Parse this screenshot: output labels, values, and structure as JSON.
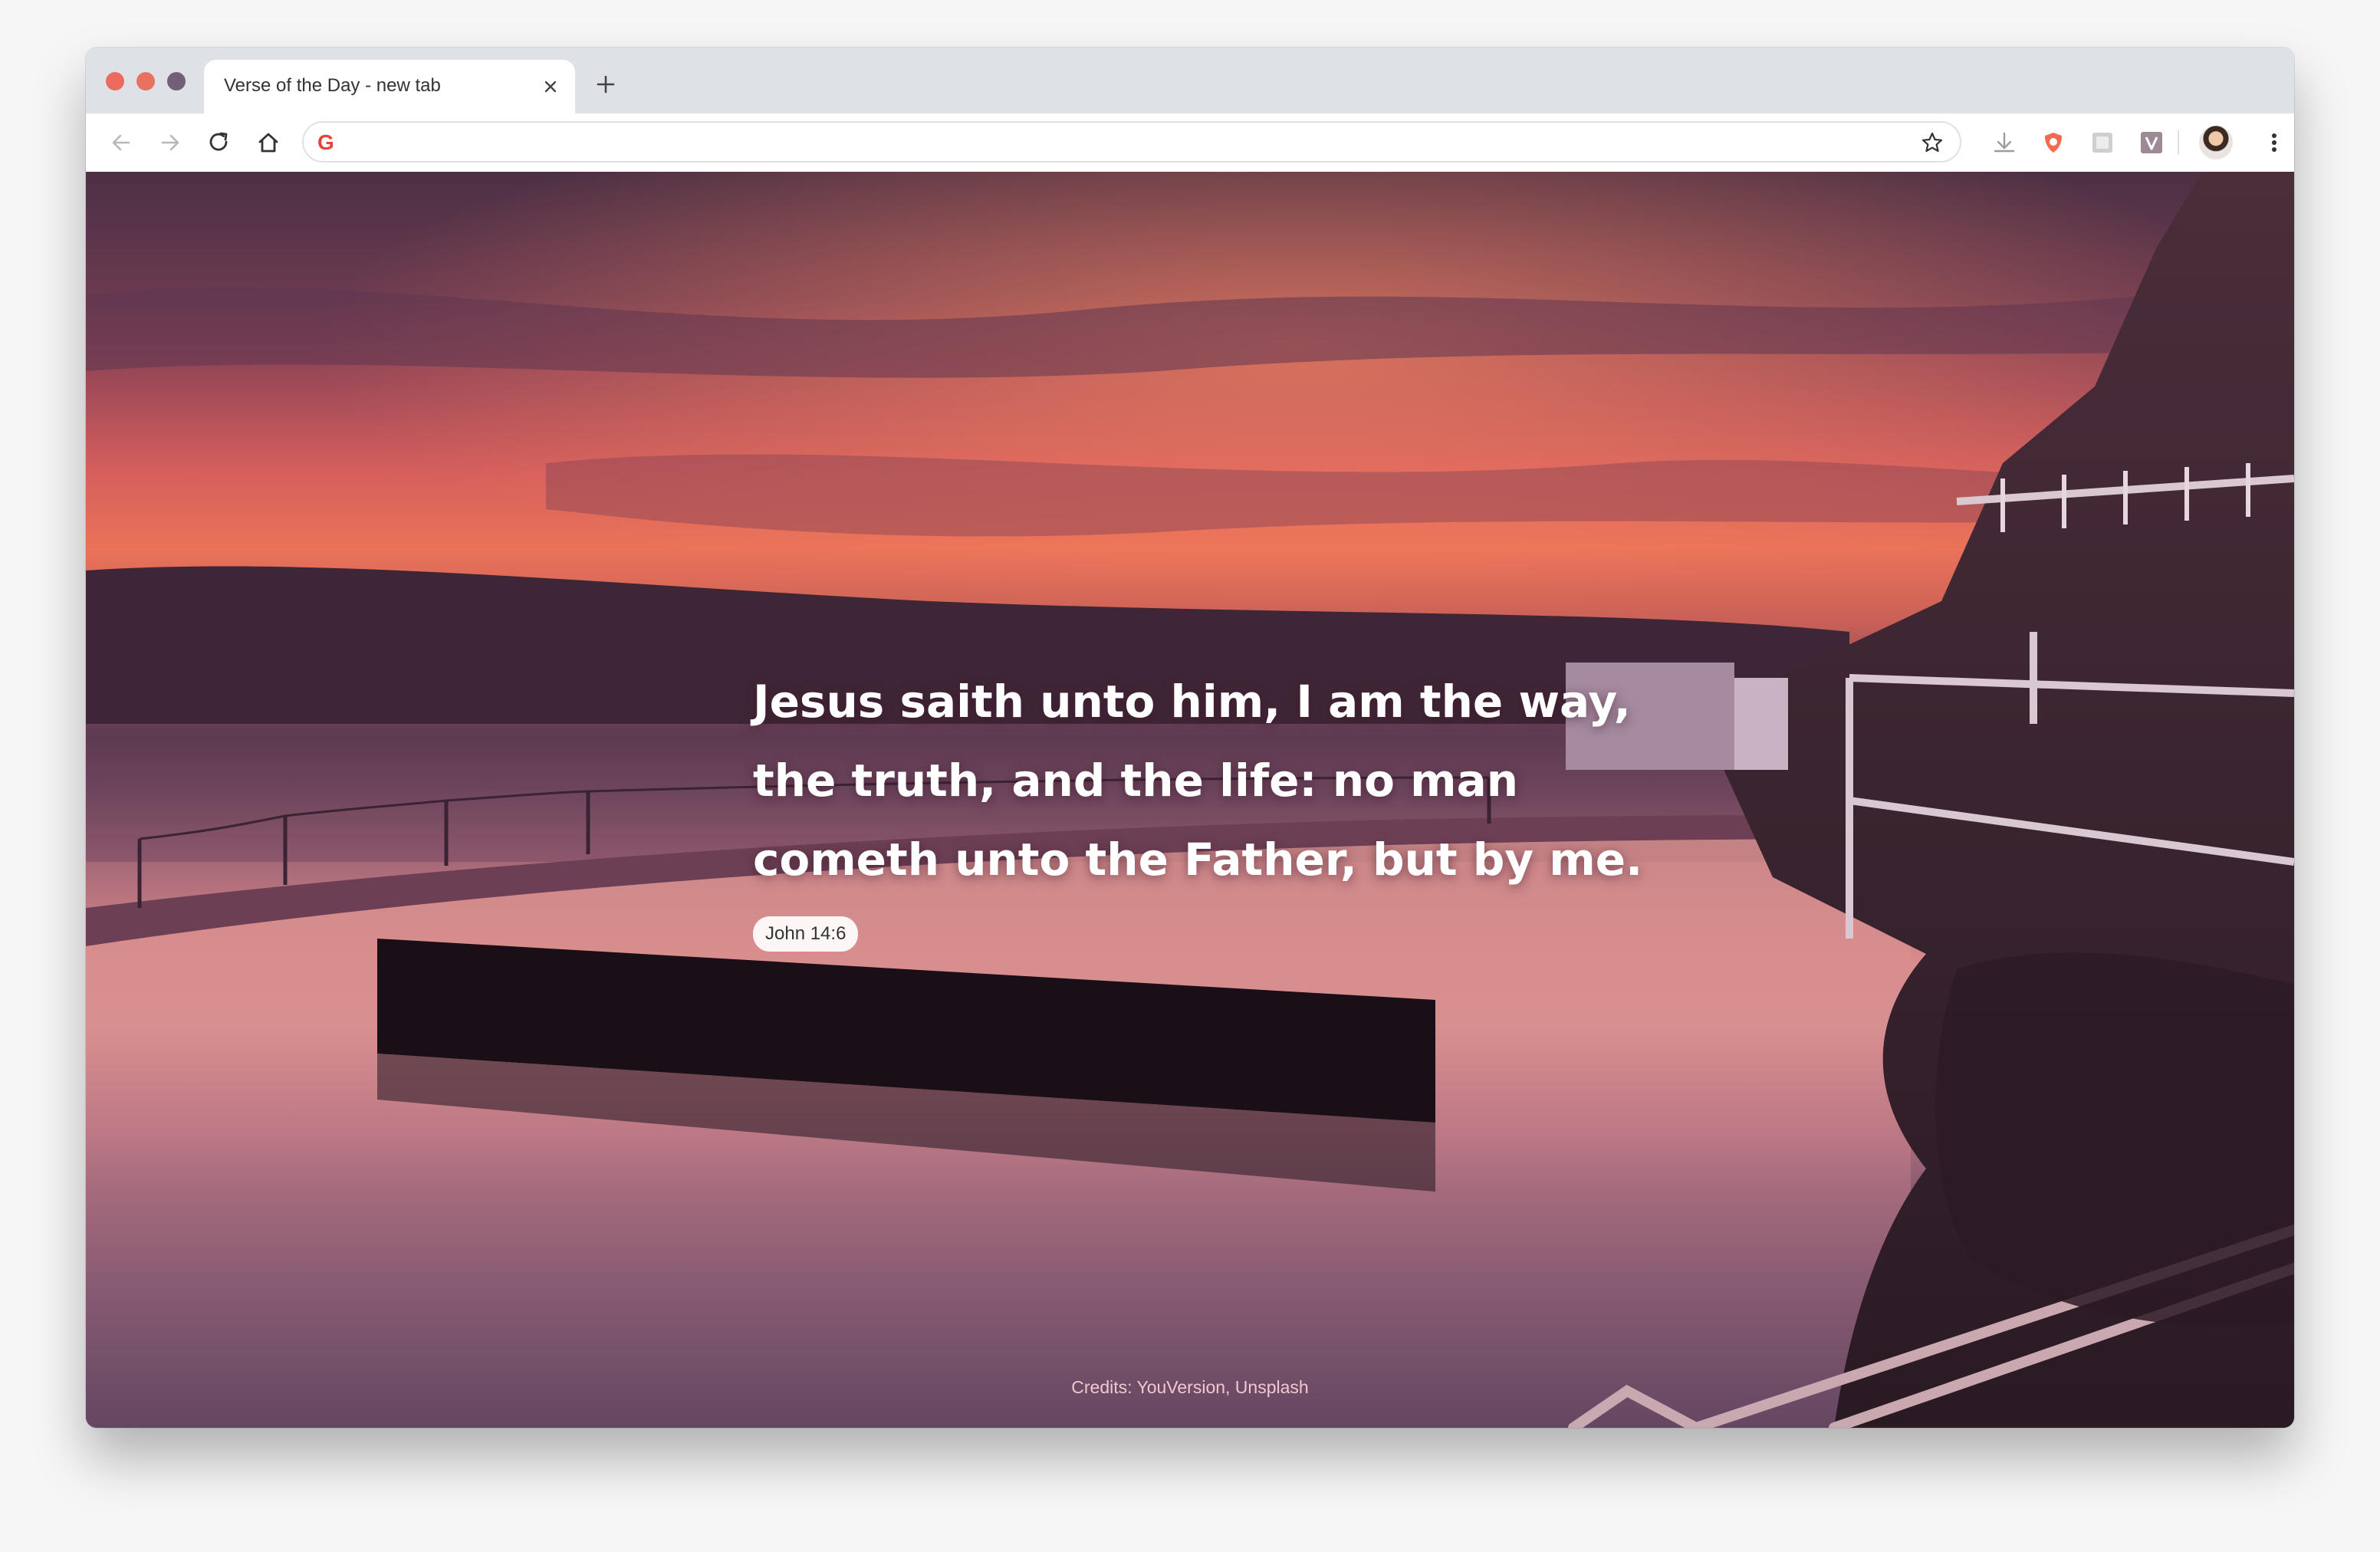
{
  "browser": {
    "tab": {
      "title": "Verse of the Day - new tab"
    },
    "omnibox": {
      "value": ""
    }
  },
  "page": {
    "verse": "Jesus saith unto him, I am the way, the truth, and the life: no man cometh unto the Father, but by me.",
    "reference": "John 14:6",
    "credits": "Credits: YouVersion, Unsplash"
  },
  "icons": {
    "back": "arrow-left-icon",
    "forward": "arrow-right-icon",
    "reload": "reload-icon",
    "home": "home-icon",
    "google": "google-g-icon",
    "bookmark": "star-icon",
    "extensions": [
      "download-extension-icon",
      "shield-extension-icon",
      "image-extension-icon",
      "v-extension-icon"
    ],
    "menu": "more-vertical-icon"
  },
  "colors": {
    "tabstrip": "#dee1e6",
    "accent_sky": "#ea7359",
    "water": "#e79d95",
    "text_overlay": "#ffffff"
  }
}
